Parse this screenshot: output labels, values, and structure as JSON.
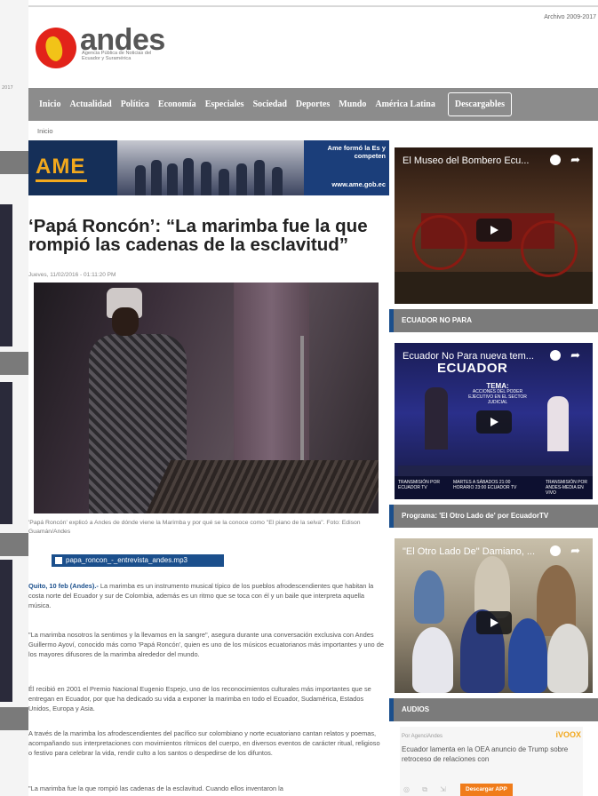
{
  "ghost_window": {
    "header_text": "2017"
  },
  "header": {
    "archive": "Archivo 2009-2017",
    "logo_word": "andes",
    "logo_tagline": "Agencia Pública de Noticias del Ecuador y Suramérica"
  },
  "nav": {
    "items": [
      "Inicio",
      "Actualidad",
      "Política",
      "Economía",
      "Especiales",
      "Sociedad",
      "Deportes",
      "Mundo",
      "América Latina"
    ],
    "boxed_item": "Descargables"
  },
  "breadcrumb": "Inicio",
  "banner": {
    "logo": "AME",
    "headline": "Ame formó la Es y competen",
    "url": "www.ame.gob.ec"
  },
  "article": {
    "title": "‘Papá Roncón’: “La marimba fue la que rompió las cadenas de la esclavitud”",
    "date": "Jueves, 11/02/2016 - 01:11:20 PM",
    "caption": "'Papá Roncón' explicó a Andes de dónde viene la Marimba y por qué se la conoce como \"El piano de la selva\". Foto: Edison Guamán/Andes",
    "audio_file": "papa_roncon_-_entrevista_andes.mp3",
    "lead_bold": "Quito, 10 feb (Andes).-",
    "lead_text": " La marimba es un instrumento musical típico de los pueblos afrodescendientes que habitan la costa norte del Ecuador y sur de Colombia, además es un ritmo que se toca con él y un baile que interpreta aquella música.",
    "p2": "\"La marimba nosotros la sentimos y la llevamos en la sangre\", asegura durante una conversación exclusiva con Andes Guillermo Ayoví, conocido más como 'Papá Roncón', quien es uno de los músicos ecuatorianos más importantes y uno de los mayores difusores de la marimba alrededor del mundo.",
    "p3": "Él recibió en 2001 el Premio Nacional Eugenio Espejo, uno de los reconocimientos culturales más importantes que se entregan en Ecuador, por que ha dedicado su vida a exponer la marimba en todo el Ecuador, Sudamérica, Estados Unidos, Europa y Asia.",
    "p4": "A través de la marimba los afrodescendientes del pacífico sur colombiano y norte ecuatoriano cantan relatos y poemas, acompañando sus interpretaciones con movimientos rítmicos del cuerpo, en diversos eventos de carácter ritual, religioso o festivo para celebrar la vida, rendir culto a los santos o despedirse de los difuntos.",
    "p5": "\"La marimba fue la que rompió las cadenas de la esclavitud. Cuando ellos inventaron la"
  },
  "sidebar": {
    "video1_title": "El Museo del Bombero Ecu...",
    "section1": "ECUADOR NO PARA",
    "video2_title": "Ecuador No Para nueva tem...",
    "video2_logo": "ECUADOR",
    "video2_tema_head": "TEMA:",
    "video2_tema": "ACCIONES DEL PODER EJECUTIVO EN EL SECTOR JUDICIAL",
    "video2_bottom_left": "TRANSMISIÓN POR ECUADOR TV",
    "video2_bottom_mid": "MARTES A SÁBADOS 21:00 HORARIO 23:00 ECUADOR TV",
    "video2_bottom_right": "TRANSMISIÓN POR ANDES-MEDIA EN VIVO",
    "section2": "Programa: 'El Otro Lado de' por EcuadorTV",
    "video3_title": "\"El Otro Lado De\" Damiano, ...",
    "section3": "AUDIOS",
    "audio_by": "Por AgenciAndes",
    "audio_brand": "iVOOX",
    "audio_text": "Ecuador lamenta en la OEA anuncio de Trump sobre retroceso de relaciones con",
    "audio_download": "Descargar APP"
  },
  "colors": {
    "nav_bg": "#8c8c8c",
    "accent_blue": "#1b4f8c",
    "logo_red": "#e2231a",
    "logo_yellow": "#f2c318",
    "download_orange": "#f07c1a"
  }
}
